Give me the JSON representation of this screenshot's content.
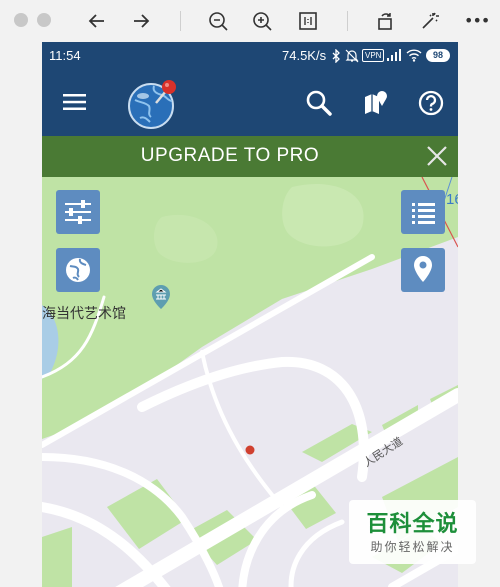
{
  "viewer": {
    "icons": [
      "close-icon",
      "minimize-icon",
      "back-arrow-icon",
      "forward-arrow-icon",
      "zoom-out-icon",
      "zoom-in-icon",
      "actual-size-icon",
      "rotate-icon",
      "magic-wand-icon",
      "more-icon"
    ],
    "more_label": "•••"
  },
  "status_bar": {
    "time": "11:54",
    "speed": "74.5K/s",
    "vpn_label": "VPN",
    "battery": "98",
    "icons": [
      "bluetooth-icon",
      "mute-icon",
      "signal-icon",
      "wifi-icon",
      "battery-icon"
    ]
  },
  "app_bar": {
    "icons": [
      "menu-icon",
      "globe-pin-logo",
      "search-icon",
      "map-style-icon",
      "help-icon"
    ]
  },
  "promo": {
    "label": "UPGRADE TO PRO",
    "close_icon": "close-icon"
  },
  "map": {
    "poi_label": "海当代艺术馆",
    "road_label": "人民大道",
    "edge_label": "16",
    "buttons": [
      "settings-sliders-icon",
      "globe-icon",
      "list-icon",
      "location-pin-icon"
    ]
  },
  "watermark": {
    "title": "百科全说",
    "subtitle": "助你轻松解决"
  },
  "colors": {
    "app_bar": "#1e4774",
    "promo": "#4a7a34",
    "map_button": "#5e8cc0",
    "park_green": "#bfe3a5",
    "building_grey": "#eae8f0",
    "water_blue": "#a9cde6"
  }
}
